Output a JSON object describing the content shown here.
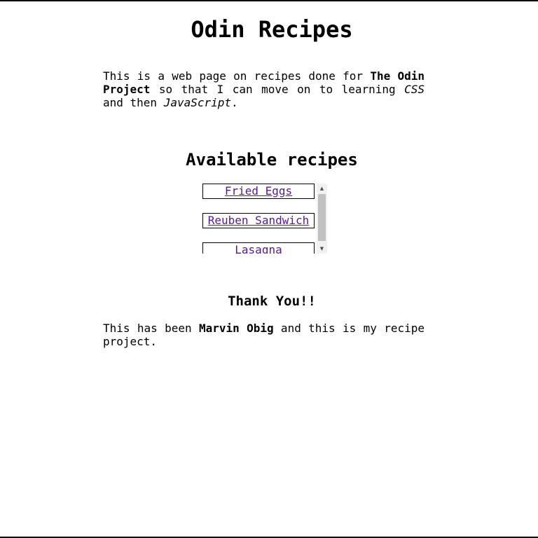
{
  "header": {
    "title": "Odin Recipes"
  },
  "intro": {
    "part1": "This is a web page on recipes done for ",
    "bold": "The Odin Project",
    "part2": " so that I can move on to learning ",
    "italic1": "CSS",
    "part3": " and then ",
    "italic2": "JavaScript",
    "part4": "."
  },
  "recipes": {
    "heading": "Available recipes",
    "items": [
      {
        "label": "Fried Eggs"
      },
      {
        "label": "Reuben Sandwich"
      },
      {
        "label": "Lasagna"
      }
    ]
  },
  "footer": {
    "heading": "Thank You!!",
    "part1": "This has been ",
    "bold": "Marvin Obig",
    "part2": " and this is my recipe project."
  },
  "colors": {
    "link": "#551a8b",
    "text": "#000000",
    "background": "#ffffff"
  },
  "icons": {
    "scroll_up": "chevron-up-icon",
    "scroll_down": "chevron-down-icon"
  }
}
